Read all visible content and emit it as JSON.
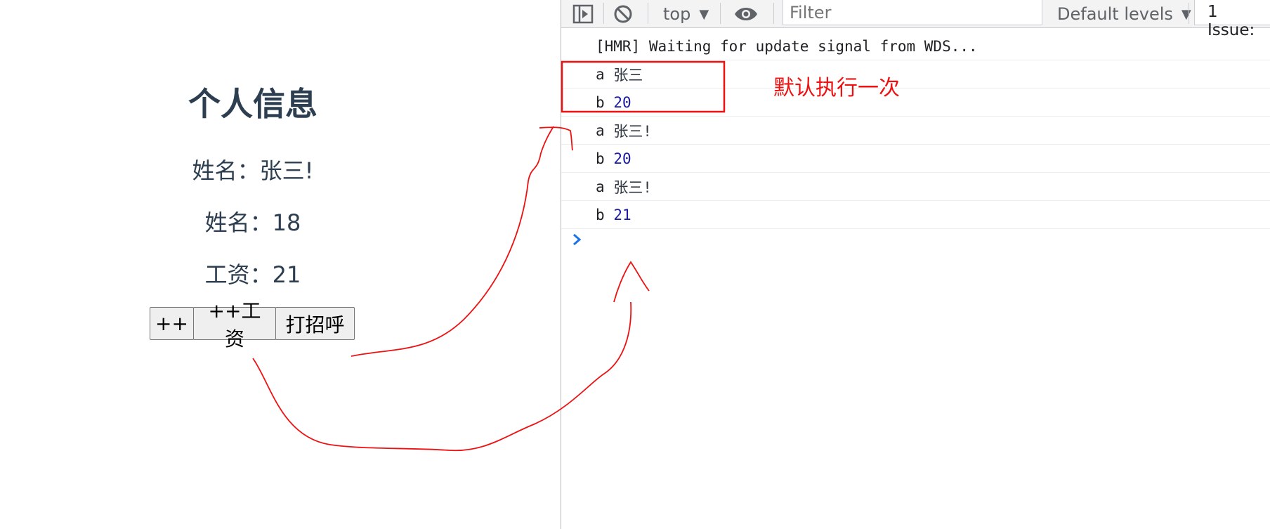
{
  "app": {
    "title": "个人信息",
    "name_line": "姓名：张三!",
    "age_line": "姓名：18",
    "salary_line": "工资：21",
    "buttons": {
      "increment": "++",
      "increment_salary": "++工资",
      "greet": "打招呼"
    }
  },
  "devtools": {
    "toolbar": {
      "context": "top",
      "filter_placeholder": "Filter",
      "levels": "Default levels",
      "issues": "1 Issue:"
    },
    "logs": [
      {
        "text": "[HMR] Waiting for update signal from WDS..."
      },
      {
        "label": "a",
        "value": "张三",
        "kind": "string"
      },
      {
        "label": "b",
        "value": "20",
        "kind": "number"
      },
      {
        "label": "a",
        "value": "张三!",
        "kind": "string"
      },
      {
        "label": "b",
        "value": "20",
        "kind": "number"
      },
      {
        "label": "a",
        "value": "张三!",
        "kind": "string"
      },
      {
        "label": "b",
        "value": "21",
        "kind": "number"
      }
    ]
  },
  "annotation": {
    "note": "默认执行一次",
    "color": "#ee1111"
  }
}
